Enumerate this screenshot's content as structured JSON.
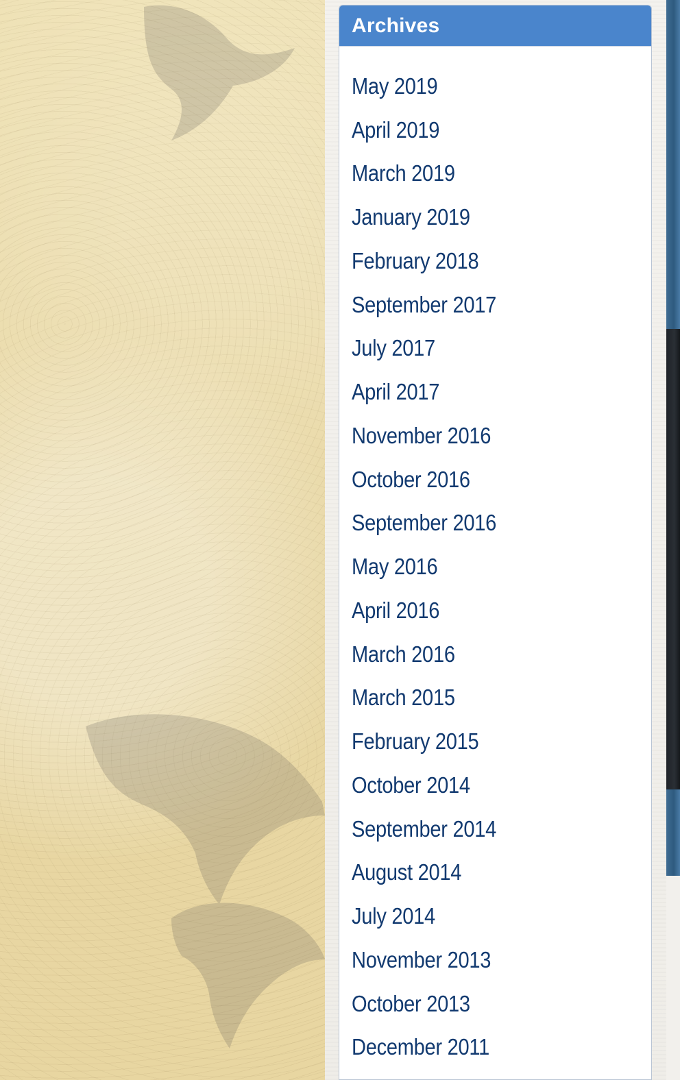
{
  "archives": {
    "title": "Archives",
    "items": [
      {
        "label": "May 2019"
      },
      {
        "label": "April 2019"
      },
      {
        "label": "March 2019"
      },
      {
        "label": "January 2019"
      },
      {
        "label": "February 2018"
      },
      {
        "label": "September 2017"
      },
      {
        "label": "July 2017"
      },
      {
        "label": "April 2017"
      },
      {
        "label": "November 2016"
      },
      {
        "label": "October 2016"
      },
      {
        "label": "September 2016"
      },
      {
        "label": "May 2016"
      },
      {
        "label": "April 2016"
      },
      {
        "label": "March 2016"
      },
      {
        "label": "March 2015"
      },
      {
        "label": "February 2015"
      },
      {
        "label": "October 2014"
      },
      {
        "label": "September 2014"
      },
      {
        "label": "August 2014"
      },
      {
        "label": "July 2014"
      },
      {
        "label": "November 2013"
      },
      {
        "label": "October 2013"
      },
      {
        "label": "December 2011"
      }
    ]
  },
  "colors": {
    "header_bg": "#4a85cc",
    "link": "#123a70",
    "parchment": "#e8d7a4"
  }
}
